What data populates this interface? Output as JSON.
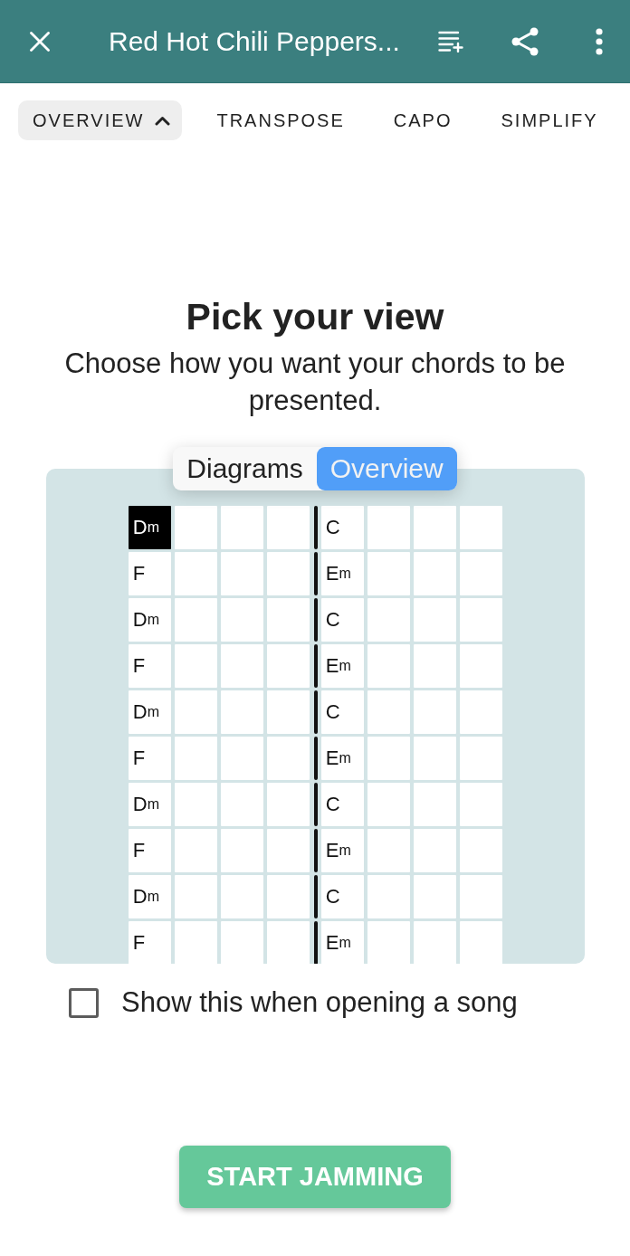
{
  "app_bar": {
    "title": "Red Hot Chili Peppers..."
  },
  "tabs": [
    {
      "label": "OVERVIEW",
      "selected": true,
      "expanded": true
    },
    {
      "label": "TRANSPOSE",
      "selected": false,
      "expanded": false
    },
    {
      "label": "CAPO",
      "selected": false,
      "expanded": false
    },
    {
      "label": "SIMPLIFY",
      "selected": false,
      "expanded": false
    }
  ],
  "view_picker": {
    "title": "Pick your view",
    "subtitle": "Choose how you want your chords to be presented.",
    "options": [
      {
        "label": "Diagrams",
        "selected": false
      },
      {
        "label": "Overview",
        "selected": true
      }
    ]
  },
  "chord_grid": {
    "rows": [
      {
        "measures": [
          {
            "chord": "Dm",
            "active": true
          },
          {
            "chord": "C",
            "active": false
          }
        ]
      },
      {
        "measures": [
          {
            "chord": "F",
            "active": false
          },
          {
            "chord": "Em",
            "active": false
          }
        ]
      },
      {
        "measures": [
          {
            "chord": "Dm",
            "active": false
          },
          {
            "chord": "C",
            "active": false
          }
        ]
      },
      {
        "measures": [
          {
            "chord": "F",
            "active": false
          },
          {
            "chord": "Em",
            "active": false
          }
        ]
      },
      {
        "measures": [
          {
            "chord": "Dm",
            "active": false
          },
          {
            "chord": "C",
            "active": false
          }
        ]
      },
      {
        "measures": [
          {
            "chord": "F",
            "active": false
          },
          {
            "chord": "Em",
            "active": false
          }
        ]
      },
      {
        "measures": [
          {
            "chord": "Dm",
            "active": false
          },
          {
            "chord": "C",
            "active": false
          }
        ]
      },
      {
        "measures": [
          {
            "chord": "F",
            "active": false
          },
          {
            "chord": "Em",
            "active": false
          }
        ]
      },
      {
        "measures": [
          {
            "chord": "Dm",
            "active": false
          },
          {
            "chord": "C",
            "active": false
          }
        ]
      },
      {
        "measures": [
          {
            "chord": "F",
            "active": false
          },
          {
            "chord": "Em",
            "active": false
          }
        ]
      }
    ]
  },
  "show_on_open": {
    "label": "Show this when opening a song",
    "checked": false
  },
  "start_button": {
    "label": "START JAMMING"
  }
}
